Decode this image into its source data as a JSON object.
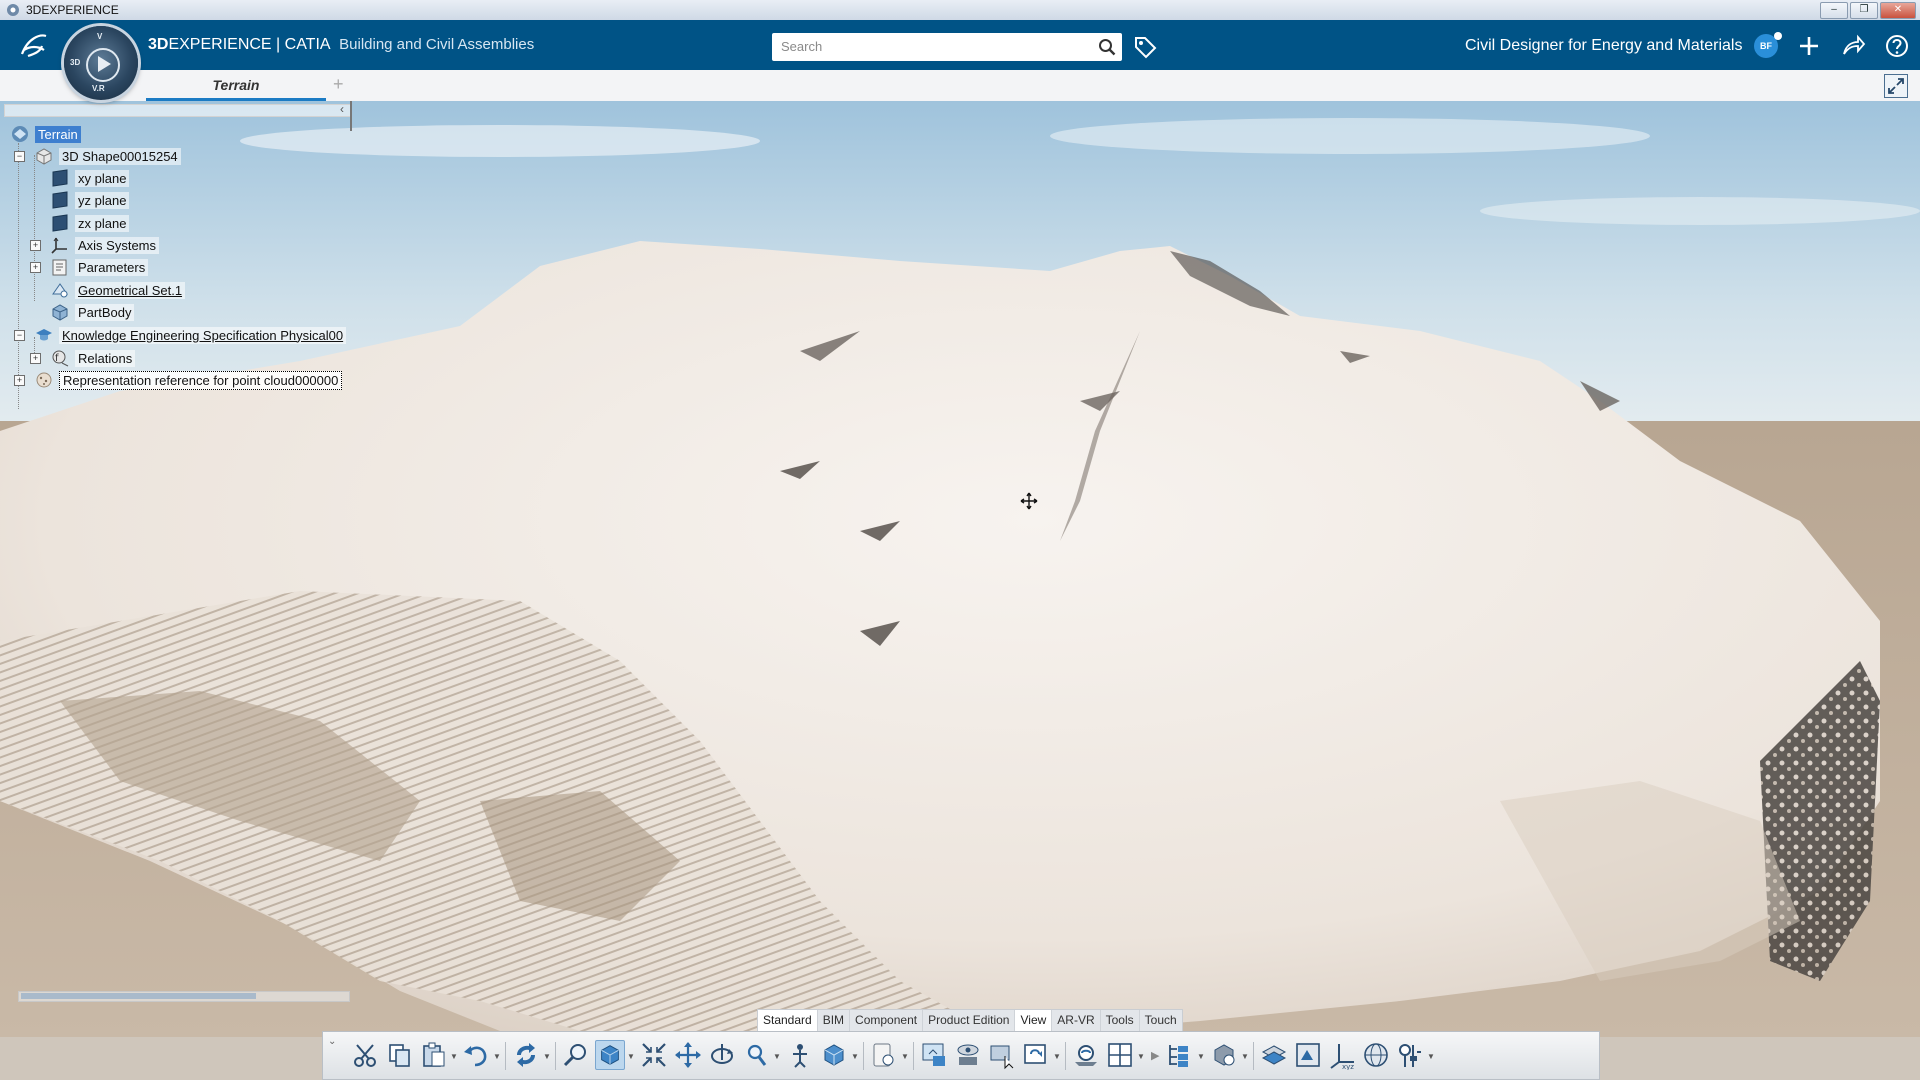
{
  "os_window": {
    "title": "3DEXPERIENCE",
    "buttons": [
      "minimize",
      "restore",
      "close"
    ]
  },
  "header": {
    "brand_bold": "3D",
    "brand_rest": "EXPERIENCE | CATIA",
    "app_name": "Building and Civil Assemblies",
    "search": {
      "placeholder": "Search",
      "value": ""
    },
    "role": "Civil Designer for Energy and Materials",
    "avatar_initials": "BF",
    "icons": [
      "ds-logo-icon",
      "compass-icon",
      "search-icon",
      "tag-icon",
      "add-icon",
      "share-icon",
      "help-icon"
    ],
    "colors": {
      "header_bg": "#005386",
      "accent": "#1b7bc4"
    }
  },
  "compass_labels": [
    "3D",
    "V.R",
    "V"
  ],
  "tabs": {
    "items": [
      {
        "label": "Terrain",
        "active": true
      }
    ],
    "add_label": "+"
  },
  "tree": {
    "collapse_arrow": "‹",
    "nodes": [
      {
        "label": "Terrain",
        "level": 0,
        "selected": true,
        "icon": "product-icon"
      },
      {
        "label": "3D Shape00015254",
        "level": 1,
        "expander": "−",
        "icon": "3d-shape-icon"
      },
      {
        "label": "xy plane",
        "level": 2,
        "icon": "plane-icon"
      },
      {
        "label": "yz plane",
        "level": 2,
        "icon": "plane-icon"
      },
      {
        "label": "zx plane",
        "level": 2,
        "icon": "plane-icon"
      },
      {
        "label": "Axis Systems",
        "level": 2,
        "expander": "+",
        "icon": "axis-system-icon"
      },
      {
        "label": "Parameters",
        "level": 2,
        "expander": "+",
        "icon": "parameters-icon"
      },
      {
        "label": "Geometrical Set.1",
        "level": 2,
        "underline": true,
        "icon": "geometrical-set-icon"
      },
      {
        "label": "PartBody",
        "level": 2,
        "icon": "partbody-icon"
      },
      {
        "label": "Knowledge Engineering Specification Physical00",
        "level": 1,
        "expander": "−",
        "underline": true,
        "icon": "knowledge-icon"
      },
      {
        "label": "Relations",
        "level": 2,
        "expander": "+",
        "icon": "relations-icon"
      },
      {
        "label": "Representation reference for point cloud000000",
        "level": 1,
        "expander": "+",
        "boxed": true,
        "icon": "point-cloud-icon"
      }
    ]
  },
  "action_bar": {
    "sections": [
      "Standard",
      "BIM",
      "Component",
      "Product Edition",
      "View",
      "AR-VR",
      "Tools",
      "Touch"
    ],
    "active_section": "View",
    "tools": [
      "cut-icon",
      "copy-icon",
      "paste-icon",
      "undo-icon",
      "update-icon",
      "zoom-area-icon",
      "isometric-view-icon",
      "fit-all-icon",
      "pan-icon",
      "rotate-icon",
      "zoom-icon",
      "fly-icon",
      "normal-view-icon",
      "render-style-icon",
      "hide-show-icon",
      "swap-visible-icon",
      "quick-view-icon",
      "lighting-icon",
      "multi-view-icon",
      "tree-expand-icon",
      "ground-icon",
      "clipping-icon",
      "capture-icon",
      "axis-xyz-icon",
      "globe-icon",
      "ambience-icon"
    ]
  }
}
